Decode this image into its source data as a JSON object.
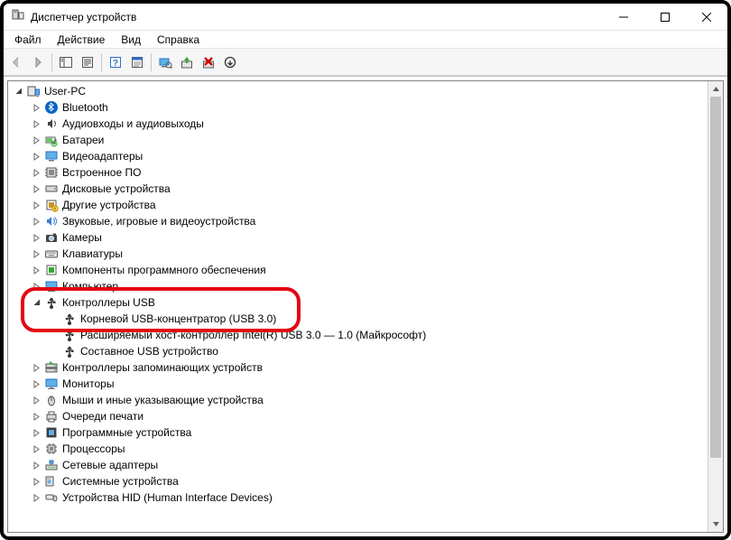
{
  "window": {
    "title": "Диспетчер устройств"
  },
  "menu": {
    "file": "Файл",
    "action": "Действие",
    "view": "Вид",
    "help": "Справка"
  },
  "tree": {
    "root": "User-PC",
    "categories": [
      {
        "label": "Bluetooth",
        "icon": "bluetooth",
        "expanded": false
      },
      {
        "label": "Аудиовходы и аудиовыходы",
        "icon": "audio",
        "expanded": false
      },
      {
        "label": "Батареи",
        "icon": "battery",
        "expanded": false
      },
      {
        "label": "Видеоадаптеры",
        "icon": "display",
        "expanded": false
      },
      {
        "label": "Встроенное ПО",
        "icon": "firmware",
        "expanded": false
      },
      {
        "label": "Дисковые устройства",
        "icon": "disk",
        "expanded": false
      },
      {
        "label": "Другие устройства",
        "icon": "other",
        "expanded": false
      },
      {
        "label": "Звуковые, игровые и видеоустройства",
        "icon": "sound",
        "expanded": false
      },
      {
        "label": "Камеры",
        "icon": "camera",
        "expanded": false
      },
      {
        "label": "Клавиатуры",
        "icon": "keyboard",
        "expanded": false
      },
      {
        "label": "Компоненты программного обеспечения",
        "icon": "software",
        "expanded": false
      },
      {
        "label": "Компьютер",
        "icon": "computer",
        "expanded": false
      },
      {
        "label": "Контроллеры USB",
        "icon": "usb",
        "expanded": true,
        "children": [
          {
            "label": "Корневой USB-концентратор (USB 3.0)",
            "icon": "usb"
          },
          {
            "label": "Расширяемый хост-контроллер Intel(R) USB 3.0 — 1.0 (Майкрософт)",
            "icon": "usb"
          },
          {
            "label": "Составное USB устройство",
            "icon": "usb"
          }
        ]
      },
      {
        "label": "Контроллеры запоминающих устройств",
        "icon": "storage",
        "expanded": false
      },
      {
        "label": "Мониторы",
        "icon": "monitor",
        "expanded": false
      },
      {
        "label": "Мыши и иные указывающие устройства",
        "icon": "mouse",
        "expanded": false
      },
      {
        "label": "Очереди печати",
        "icon": "printer",
        "expanded": false
      },
      {
        "label": "Программные устройства",
        "icon": "softwaredev",
        "expanded": false
      },
      {
        "label": "Процессоры",
        "icon": "cpu",
        "expanded": false
      },
      {
        "label": "Сетевые адаптеры",
        "icon": "network",
        "expanded": false
      },
      {
        "label": "Системные устройства",
        "icon": "system",
        "expanded": false
      },
      {
        "label": "Устройства HID (Human Interface Devices)",
        "icon": "hid",
        "expanded": false
      }
    ]
  },
  "highlight": {
    "category_label": "Контроллеры USB",
    "child_label": "Корневой USB-концентратор (USB 3.0)"
  }
}
